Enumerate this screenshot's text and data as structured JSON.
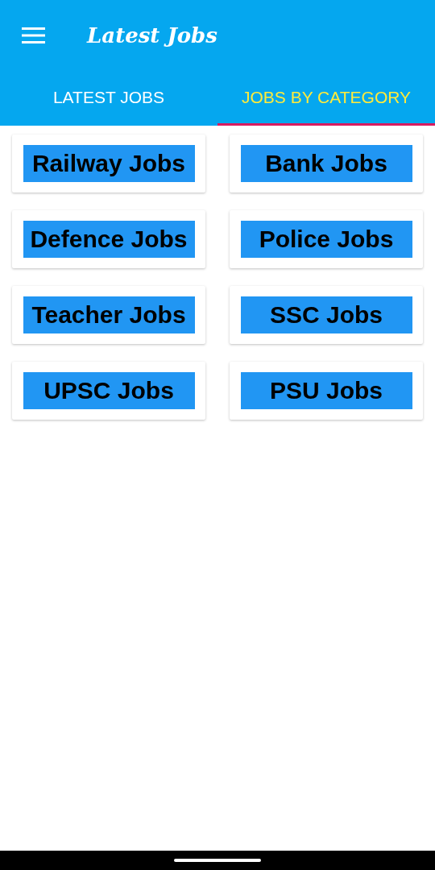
{
  "app_bar": {
    "title": "Latest Jobs"
  },
  "tabs": [
    {
      "label": "LATEST JOBS",
      "selected": false
    },
    {
      "label": "JOBS BY CATEGORY",
      "selected": true
    }
  ],
  "categories": [
    {
      "label": "Railway Jobs"
    },
    {
      "label": "Bank Jobs"
    },
    {
      "label": "Defence Jobs"
    },
    {
      "label": "Police Jobs"
    },
    {
      "label": "Teacher Jobs"
    },
    {
      "label": "SSC Jobs"
    },
    {
      "label": "UPSC Jobs"
    },
    {
      "label": "PSU Jobs"
    }
  ]
}
